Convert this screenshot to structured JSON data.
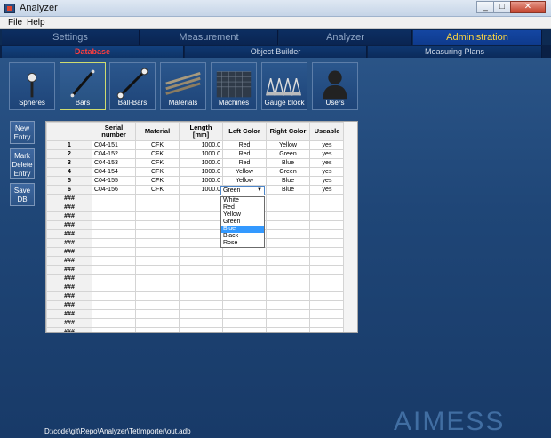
{
  "window": {
    "title": "Analyzer",
    "minimize": "_",
    "maximize": "□",
    "close": "✕"
  },
  "menu": {
    "file": "File",
    "help": "Help"
  },
  "main_tabs": [
    "Settings",
    "Measurement",
    "Analyzer",
    "Administration"
  ],
  "sub_tabs": [
    "Database",
    "Object Builder",
    "Measuring Plans"
  ],
  "toolbar": [
    "Spheres",
    "Bars",
    "Ball-Bars",
    "Materials",
    "Machines",
    "Gauge block",
    "Users"
  ],
  "side_buttons": {
    "new_entry": "New Entry",
    "mark_delete": "Mark Delete Entry",
    "save_db": "Save DB"
  },
  "table": {
    "headers": [
      "",
      "Serial number",
      "Material",
      "Length [mm]",
      "Left Color",
      "Right Color",
      "Useable"
    ],
    "rows": [
      [
        "1",
        "C04-151",
        "CFK",
        "1000.0",
        "Red",
        "Yellow",
        "yes"
      ],
      [
        "2",
        "C04-152",
        "CFK",
        "1000.0",
        "Red",
        "Green",
        "yes"
      ],
      [
        "3",
        "C04-153",
        "CFK",
        "1000.0",
        "Red",
        "Blue",
        "yes"
      ],
      [
        "4",
        "C04-154",
        "CFK",
        "1000.0",
        "Yellow",
        "Green",
        "yes"
      ],
      [
        "5",
        "C04-155",
        "CFK",
        "1000.0",
        "Yellow",
        "Blue",
        "yes"
      ],
      [
        "6",
        "C04-156",
        "CFK",
        "1000.0",
        "",
        "Blue",
        "yes"
      ]
    ],
    "placeholder": "###"
  },
  "dropdown": {
    "value": "Green",
    "options": [
      "White",
      "Red",
      "Yellow",
      "Green",
      "Blue",
      "Black",
      "Rose"
    ],
    "highlighted": "Blue"
  },
  "status_path": "D:\\code\\git\\Repo\\Analyzer\\TetImporter\\out.adb",
  "brand": "AIMESS"
}
